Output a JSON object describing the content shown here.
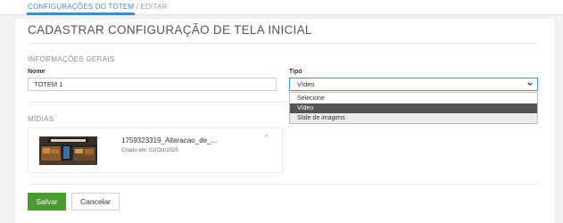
{
  "breadcrumb": {
    "active": "CONFIGURAÇÕES DO TOTEM",
    "separator": " / ",
    "current": "EDITAR"
  },
  "page": {
    "title": "CADASTRAR CONFIGURAÇÃO DE TELA INICIAL"
  },
  "general": {
    "section_title": "INFORMAÇÕES GERAIS",
    "name_label": "Nome",
    "name_value": "TOTEM 1",
    "type_label": "Tipo",
    "type_value": "Vídeo",
    "type_options": [
      "Selecione",
      "Vídeo",
      "Slide de imagens"
    ],
    "type_selected_index": 1
  },
  "media": {
    "section_title": "MÍDIAS",
    "items": [
      {
        "name": "1759323319_Alteracao_de_...",
        "created": "Criado em: 01/Oct/2025",
        "close": "×"
      }
    ]
  },
  "actions": {
    "save_label": "Salvar",
    "cancel_label": "Cancelar"
  },
  "colors": {
    "accent": "#3a8ed4",
    "save": "#4a9a32",
    "selected_option": "#555555"
  },
  "icons": {
    "select_chevron": "chevron-down-icon",
    "close": "close-icon"
  }
}
